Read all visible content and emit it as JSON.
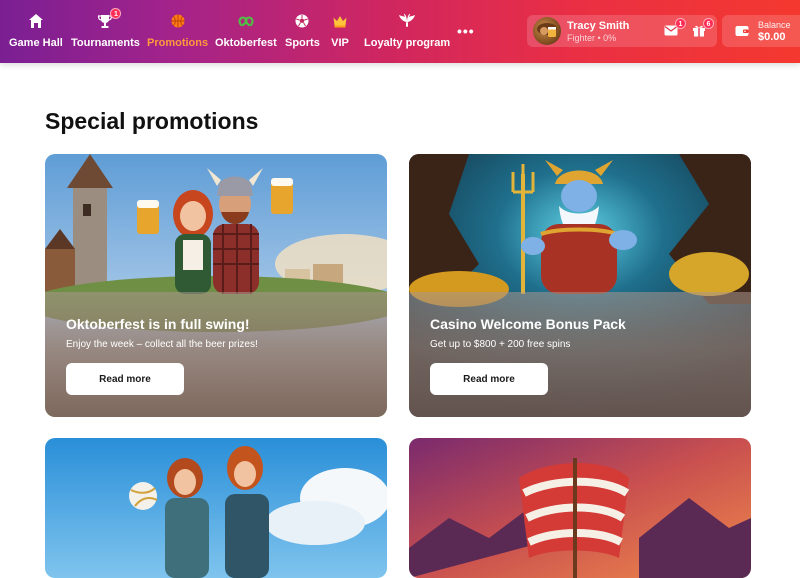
{
  "nav": {
    "items": [
      {
        "label": "Game Hall",
        "icon": "home-icon"
      },
      {
        "label": "Tournaments",
        "icon": "trophy-icon",
        "badge": "1"
      },
      {
        "label": "Promotions",
        "icon": "basketball-icon",
        "active": true
      },
      {
        "label": "Oktoberfest",
        "icon": "pretzel-icon"
      },
      {
        "label": "Sports",
        "icon": "soccer-ball-icon"
      },
      {
        "label": "VIP",
        "icon": "crown-icon"
      },
      {
        "label": "Loyalty program",
        "icon": "wings-icon"
      }
    ],
    "more": "•••"
  },
  "user": {
    "name": "Tracy Smith",
    "rank": "Fighter • 0%",
    "messages_badge": "1",
    "gifts_badge": "6"
  },
  "balance": {
    "label": "Balance",
    "value": "$0.00"
  },
  "page": {
    "title": "Special promotions"
  },
  "promotions": [
    {
      "title": "Oktoberfest is in full swing!",
      "subtitle": "Enjoy the week – collect all the beer prizes!",
      "button": "Read more"
    },
    {
      "title": "Casino Welcome Bonus Pack",
      "subtitle": "Get up to $800 + 200 free spins",
      "button": "Read more"
    }
  ],
  "colors": {
    "header_start": "#7a1f93",
    "header_end": "#f4382f",
    "active_nav": "#ff9a3c",
    "badge": "#ff2d55"
  }
}
